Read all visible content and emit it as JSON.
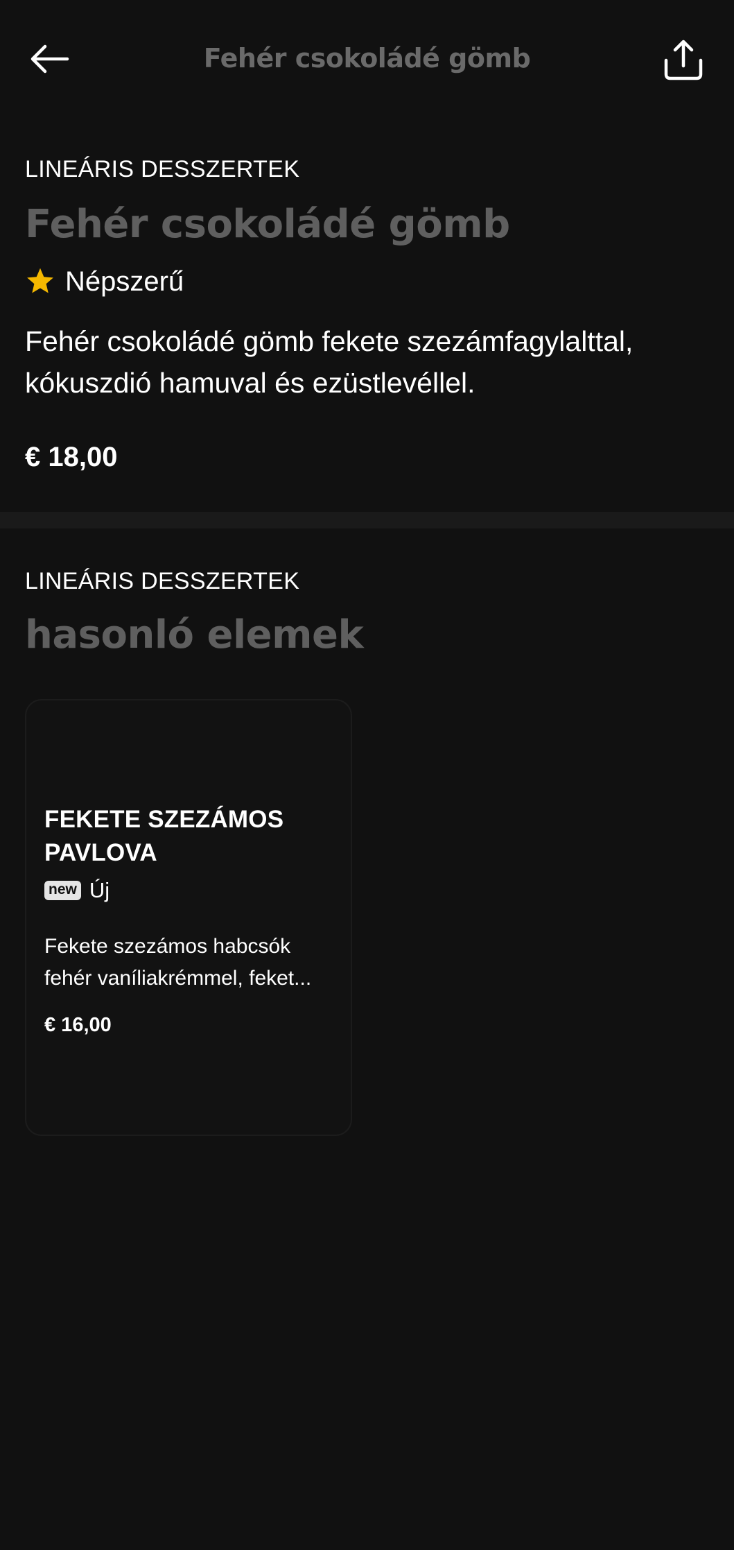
{
  "header": {
    "title": "Fehér csokoládé gömb",
    "back_icon": "arrow-left-icon",
    "share_icon": "share-icon"
  },
  "product": {
    "category": "LINEÁRIS DESSZERTEK",
    "name": "Fehér csokoládé gömb",
    "tag_icon": "star-icon",
    "tag_label": "Népszerű",
    "description": "Fehér csokoládé gömb fekete szezámfagylalttal, kókuszdió hamuval és ezüstlevéllel.",
    "price": "€ 18,00"
  },
  "similar": {
    "category": "LINEÁRIS DESSZERTEK",
    "heading": "hasonló elemek",
    "items": [
      {
        "name": "FEKETE SZEZÁMOS PAVLOVA",
        "badge": "new",
        "badge_label": "Új",
        "description_line1": "Fekete szezámos habcsók",
        "description_line2": "fehér vaníliakrémmel, feket...",
        "price": "€ 16,00"
      }
    ]
  },
  "colors": {
    "background": "#111111",
    "muted_title": "#5f5f5f",
    "star": "#f5b800",
    "divider": "#1a1a1a"
  }
}
